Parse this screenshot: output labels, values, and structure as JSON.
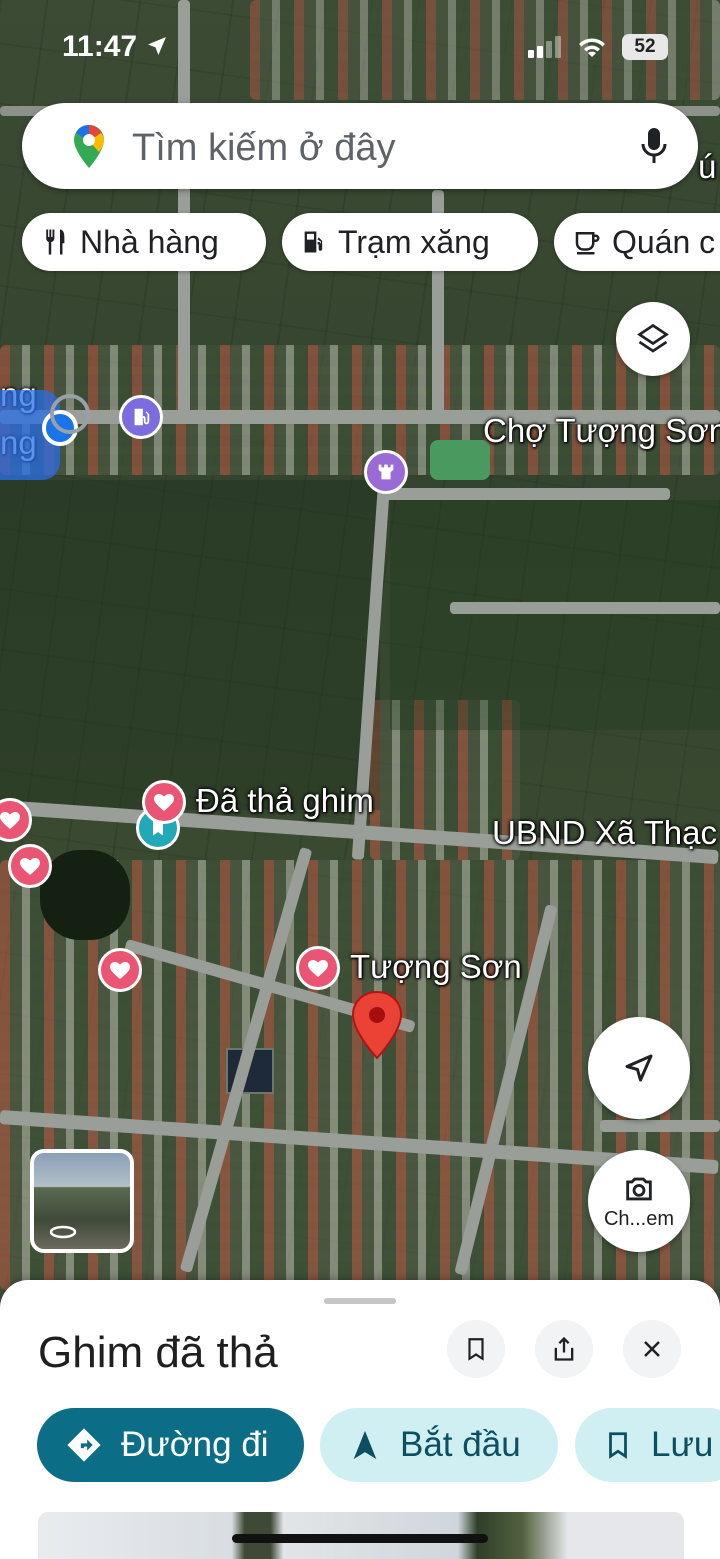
{
  "status_bar": {
    "time": "11:47",
    "battery": "52"
  },
  "search": {
    "placeholder": "Tìm kiếm ở đây"
  },
  "chips": [
    {
      "label": "Nhà hàng",
      "icon": "restaurant-icon"
    },
    {
      "label": "Trạm xăng",
      "icon": "gas-station-icon"
    },
    {
      "label": "Quán c",
      "icon": "coffee-icon"
    }
  ],
  "map": {
    "labels": {
      "market": "Chợ Tượng Sơn",
      "dropped_pin": "Đã thả ghim",
      "ubnd": "UBND Xã Thạc",
      "tuong_son": "Tượng Sơn",
      "partial_left_1": "ng",
      "partial_left_2": "ng",
      "partial_top_right": "ú"
    }
  },
  "camera_button": {
    "label": "Ch...em"
  },
  "sheet": {
    "title": "Ghim đã thả",
    "actions": [
      {
        "label": "Đường đi",
        "icon": "directions-icon",
        "color": "#0b6e86"
      },
      {
        "label": "Bắt đầu",
        "icon": "navigation-arrow-icon",
        "color": "#cfeff3"
      },
      {
        "label": "Lưu",
        "icon": "bookmark-icon",
        "color": "#cfeff3"
      }
    ]
  }
}
